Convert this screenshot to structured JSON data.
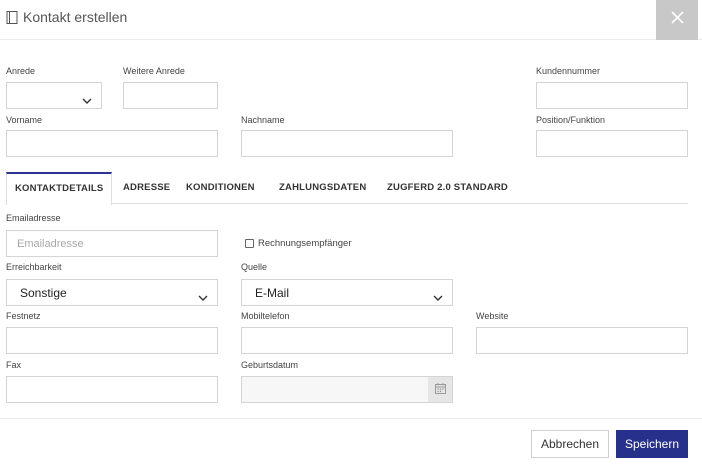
{
  "dialog": {
    "title": "Kontakt erstellen",
    "close_symbol": "✕",
    "icons": {
      "title": "address-book-icon",
      "close": "close-icon",
      "calendar": "calendar-icon",
      "dropdown": "chevron-down-icon"
    }
  },
  "person": {
    "anrede": {
      "label": "Anrede",
      "value": ""
    },
    "weitere_anrede": {
      "label": "Weitere Anrede",
      "value": ""
    },
    "kundennummer": {
      "label": "Kundennummer",
      "value": ""
    },
    "vorname": {
      "label": "Vorname",
      "value": ""
    },
    "nachname": {
      "label": "Nachname",
      "value": ""
    },
    "position": {
      "label": "Position/Funktion",
      "value": ""
    }
  },
  "tabs": [
    {
      "label": "KONTAKTDETAILS",
      "active": true
    },
    {
      "label": "ADRESSE",
      "active": false
    },
    {
      "label": "KONDITIONEN",
      "active": false
    },
    {
      "label": "ZAHLUNGSDATEN",
      "active": false
    },
    {
      "label": "ZUGFERD 2.0 STANDARD",
      "active": false
    }
  ],
  "details": {
    "email": {
      "label": "Emailadresse",
      "placeholder": "Emailadresse",
      "value": ""
    },
    "rechnungsempfaenger": {
      "label": "Rechnungsempfänger",
      "checked": false
    },
    "erreichbarkeit": {
      "label": "Erreichbarkeit",
      "value": "Sonstige"
    },
    "quelle": {
      "label": "Quelle",
      "value": "E-Mail"
    },
    "festnetz": {
      "label": "Festnetz",
      "value": ""
    },
    "mobiltelefon": {
      "label": "Mobiltelefon",
      "value": ""
    },
    "website": {
      "label": "Website",
      "value": ""
    },
    "fax": {
      "label": "Fax",
      "value": ""
    },
    "geburtsdatum": {
      "label": "Geburtsdatum",
      "value": ""
    }
  },
  "footer": {
    "cancel_label": "Abbrechen",
    "save_label": "Speichern"
  },
  "colors": {
    "primary": "#27318c",
    "tab_accent": "#2b3591",
    "close_bg": "#c8c8c8",
    "border": "#d4d4d4"
  }
}
